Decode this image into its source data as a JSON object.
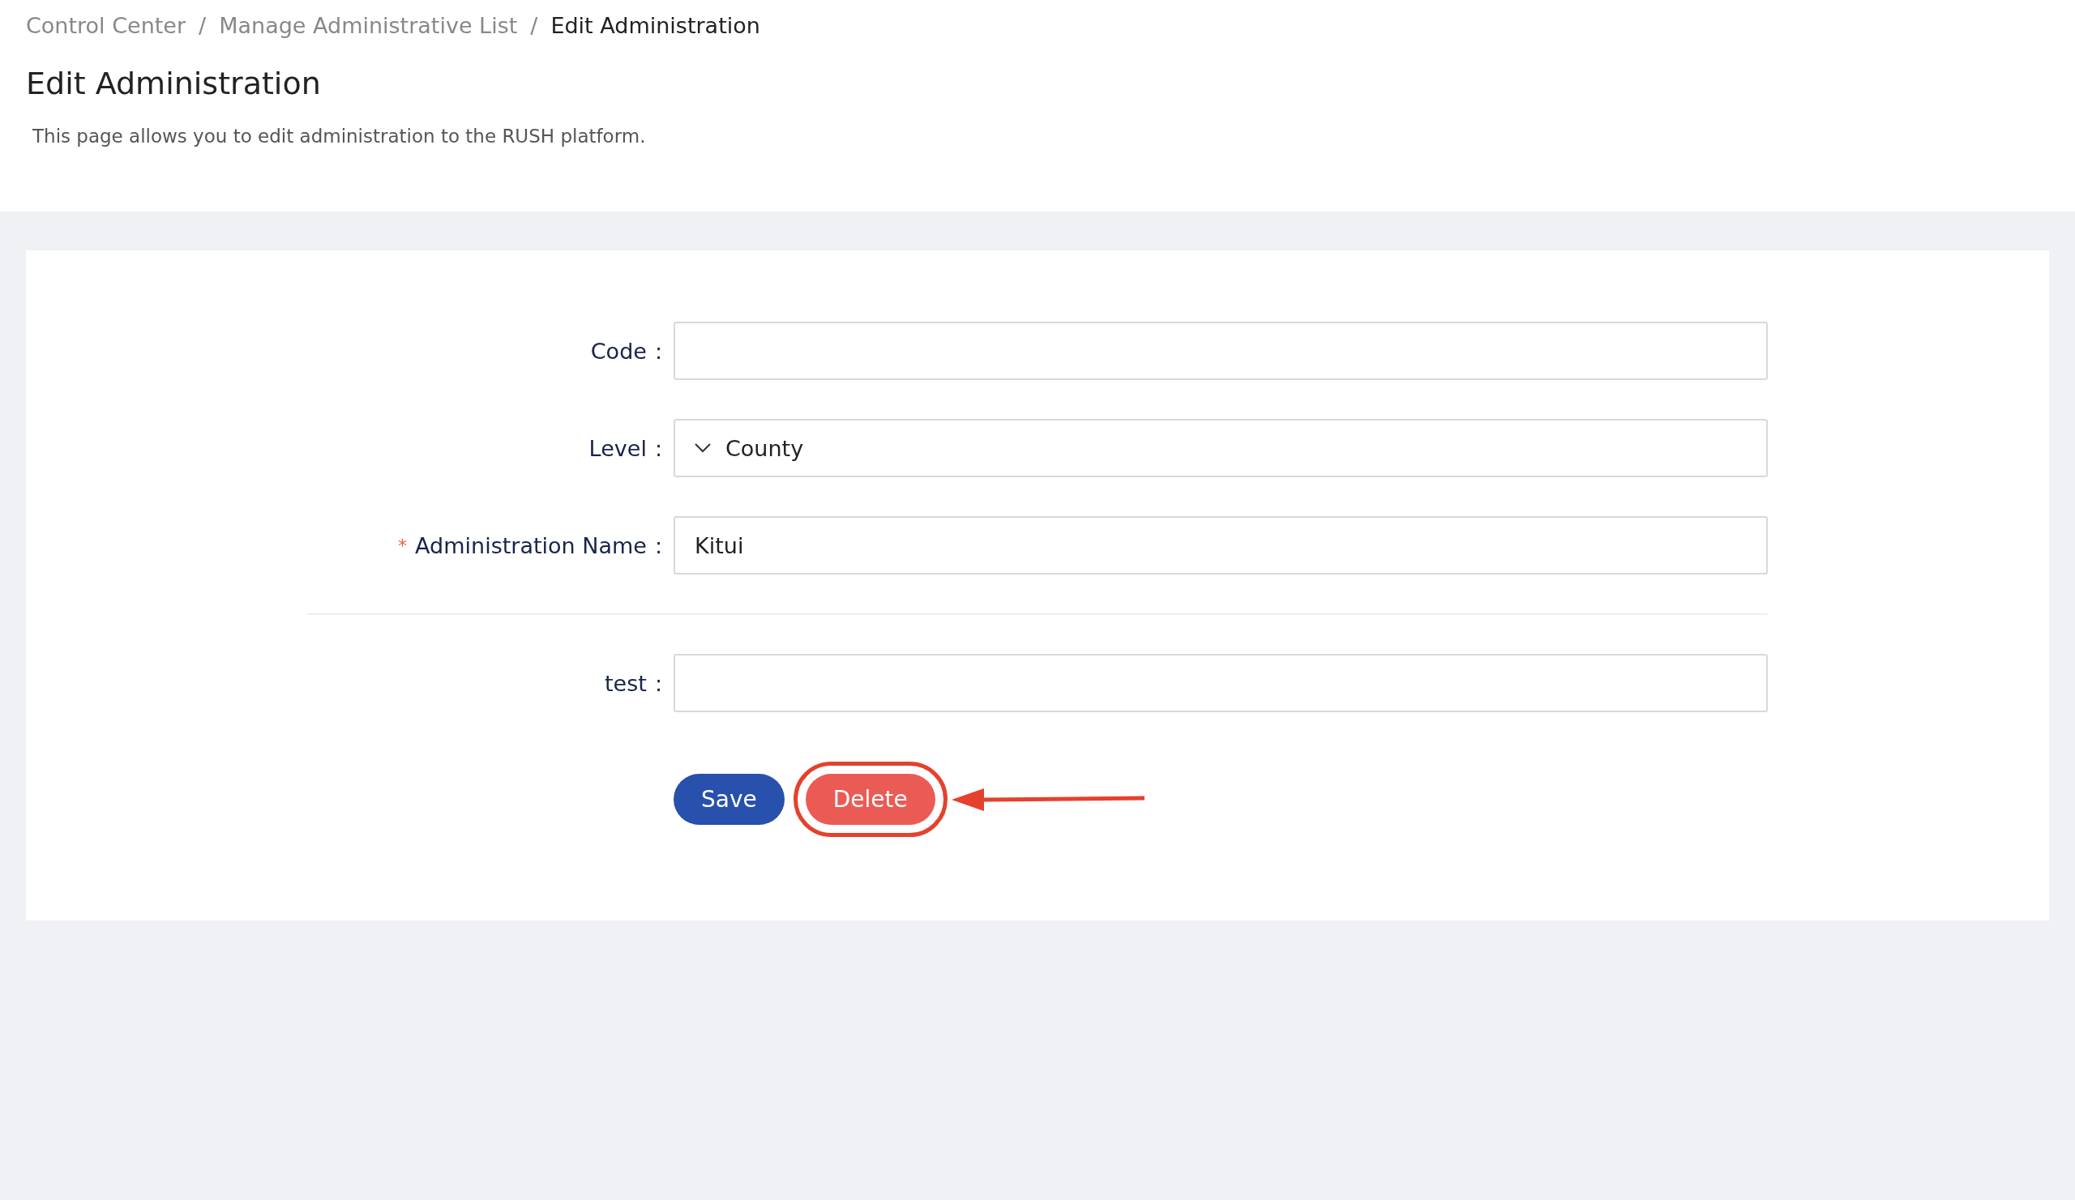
{
  "breadcrumb": [
    {
      "label": "Control Center",
      "current": false
    },
    {
      "label": "Manage Administrative List",
      "current": false
    },
    {
      "label": "Edit Administration",
      "current": true
    }
  ],
  "breadcrumb_separators": [
    "/",
    "/"
  ],
  "title": "Edit Administration",
  "description": "This page allows you to edit administration to the RUSH platform.",
  "sections": [
    {
      "fields": [
        {
          "kind": "input",
          "label": "Code",
          "colon": ":"
        },
        {
          "kind": "select",
          "label": "Level",
          "colon": ":",
          "value": "County"
        },
        {
          "kind": "input",
          "label": "Administration Name",
          "colon": ":",
          "value": "Kitui",
          "required_mark": "*"
        }
      ]
    },
    {
      "fields": [
        {
          "kind": "input",
          "label": "test",
          "colon": ":"
        }
      ]
    }
  ],
  "buttons": [
    {
      "kind": "primary",
      "label": "Save",
      "highlighted": false
    },
    {
      "kind": "danger",
      "label": "Delete",
      "highlighted": true
    }
  ]
}
